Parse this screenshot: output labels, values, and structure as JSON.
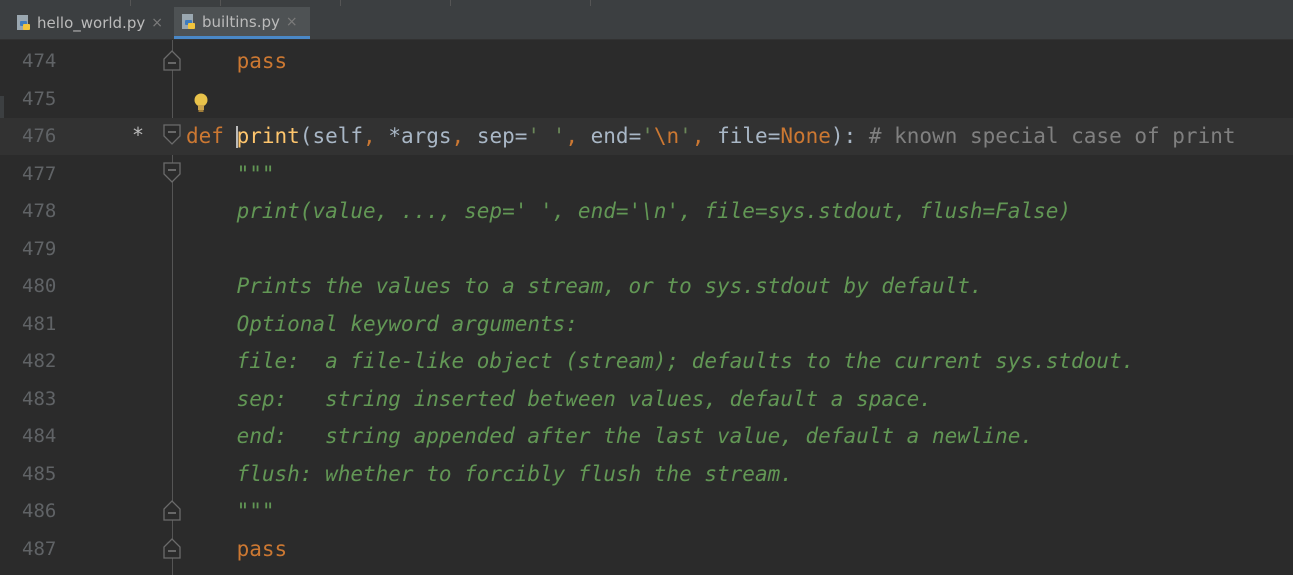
{
  "tabs": [
    {
      "label": "hello_world.py",
      "active": false,
      "icon": "python-file-icon"
    },
    {
      "label": "builtins.py",
      "active": true,
      "icon": "python-file-icon"
    }
  ],
  "close_glyph": "×",
  "gutter": {
    "modified_marker": "*"
  },
  "lines": [
    {
      "no": "474",
      "tokens": [
        [
          "pl",
          "    "
        ],
        [
          "kw",
          "pass"
        ]
      ]
    },
    {
      "no": "475",
      "tokens": []
    },
    {
      "no": "476",
      "tokens": [
        [
          "kw",
          "def "
        ],
        [
          "fn",
          "print"
        ],
        [
          "pl",
          "(self"
        ],
        [
          "kw",
          ", "
        ],
        [
          "pl",
          "*args"
        ],
        [
          "kw",
          ", "
        ],
        [
          "pl",
          "sep="
        ],
        [
          "str",
          "' '"
        ],
        [
          "kw",
          ", "
        ],
        [
          "pl",
          "end="
        ],
        [
          "str",
          "'"
        ],
        [
          "esc",
          "\\n"
        ],
        [
          "str",
          "'"
        ],
        [
          "kw",
          ", "
        ],
        [
          "pl",
          "file="
        ],
        [
          "kw",
          "None"
        ],
        [
          "pl",
          "): "
        ],
        [
          "cm",
          "# known special case of print"
        ]
      ]
    },
    {
      "no": "477",
      "tokens": [
        [
          "doc",
          "    \"\"\""
        ]
      ]
    },
    {
      "no": "478",
      "tokens": [
        [
          "doc",
          "    print(value, ..., sep=' ', end='\\n', file=sys.stdout, flush=False)"
        ]
      ]
    },
    {
      "no": "479",
      "tokens": []
    },
    {
      "no": "480",
      "tokens": [
        [
          "doc",
          "    Prints the values to a stream, or to sys.stdout by default."
        ]
      ]
    },
    {
      "no": "481",
      "tokens": [
        [
          "doc",
          "    Optional keyword arguments:"
        ]
      ]
    },
    {
      "no": "482",
      "tokens": [
        [
          "doc",
          "    file:  a file-like object (stream); defaults to the current sys.stdout."
        ]
      ]
    },
    {
      "no": "483",
      "tokens": [
        [
          "doc",
          "    sep:   string inserted between values, default a space."
        ]
      ]
    },
    {
      "no": "484",
      "tokens": [
        [
          "doc",
          "    end:   string appended after the last value, default a newline."
        ]
      ]
    },
    {
      "no": "485",
      "tokens": [
        [
          "doc",
          "    flush: whether to forcibly flush the stream."
        ]
      ]
    },
    {
      "no": "486",
      "tokens": [
        [
          "doc",
          "    \"\"\""
        ]
      ]
    },
    {
      "no": "487",
      "tokens": [
        [
          "pl",
          "    "
        ],
        [
          "kw",
          "pass"
        ]
      ]
    }
  ]
}
